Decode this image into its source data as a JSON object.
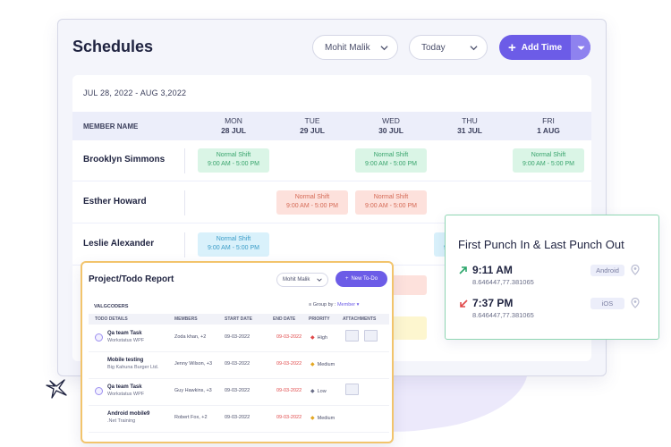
{
  "schedules": {
    "title": "Schedules",
    "member_select": "Mohit Malik",
    "range_select": "Today",
    "add_time_label": "Add Time",
    "date_range": "JUL 28, 2022 - AUG 3,2022",
    "member_column_header": "MEMBER NAME",
    "days": [
      {
        "weekday": "MON",
        "date": "28 JUL"
      },
      {
        "weekday": "TUE",
        "date": "29 JUL"
      },
      {
        "weekday": "WED",
        "date": "30 JUL"
      },
      {
        "weekday": "THU",
        "date": "31 JUL"
      },
      {
        "weekday": "FRI",
        "date": "1 AUG"
      }
    ],
    "rows": [
      {
        "name": "Brooklyn Simmons"
      },
      {
        "name": "Esther Howard"
      },
      {
        "name": "Leslie Alexander"
      }
    ],
    "shift_title": "Normal Shift",
    "shift_time": "9:00 AM - 5:00 PM",
    "colors": {
      "accent": "#6c5ce7",
      "green": "#daf5e6",
      "red": "#fde1dc",
      "blue": "#d9f1fb",
      "yellow": "#fdf6cf"
    }
  },
  "punch": {
    "title": "First Punch In & Last Punch Out",
    "entries": [
      {
        "time": "9:11 AM",
        "coords": "8.646447,77.381065",
        "device": "Android",
        "icon": "arrow-up-right-icon",
        "color": "#2aa56a"
      },
      {
        "time": "7:37 PM",
        "coords": "8.646447,77.381065",
        "device": "iOS",
        "icon": "arrow-down-left-icon",
        "color": "#e0494a"
      }
    ]
  },
  "todo": {
    "title": "Project/Todo Report",
    "member_select": "Mohit Malik",
    "new_button": "New To-Do",
    "org": "VALGCODERS",
    "group_by_label": "Group by :",
    "group_by_value": "Member",
    "columns": [
      "TODO DETAILS",
      "MEMBERS",
      "START DATE",
      "END DATE",
      "PRIORITY",
      "ATTACHMENTS"
    ],
    "rows": [
      {
        "name": "Qa team Task",
        "project": "Workstatus WPF",
        "members": "Zoda khan, +2",
        "start": "09-03-2022",
        "end": "09-03-2022",
        "priority": "High"
      },
      {
        "name": "Mobile testing",
        "project": "Big Kahuna Burger Ltd.",
        "members": "Jenny Wilson, +3",
        "start": "09-03-2022",
        "end": "09-03-2022",
        "priority": "Medium"
      },
      {
        "name": "Qa team Task",
        "project": "Workstatus WPF",
        "members": "Guy Hawkins, +3",
        "start": "09-03-2022",
        "end": "09-03-2022",
        "priority": "Low"
      },
      {
        "name": "Android mobile9",
        "project": ".Net Training",
        "members": "Robert Fox, +2",
        "start": "09-03-2022",
        "end": "09-03-2022",
        "priority": "Medium"
      }
    ]
  }
}
